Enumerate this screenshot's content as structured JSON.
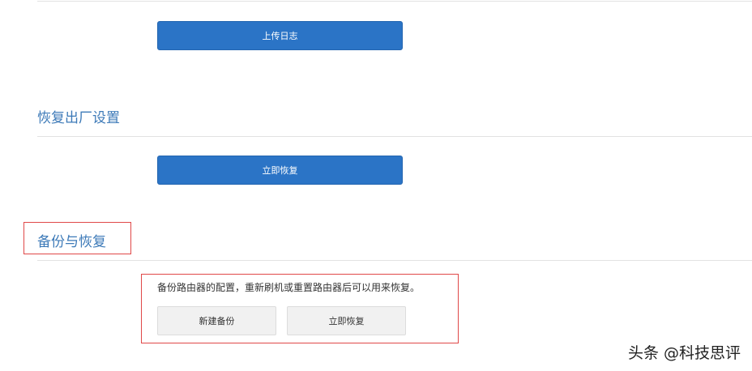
{
  "upload_log": {
    "button_label": "上传日志"
  },
  "factory_reset": {
    "title": "恢复出厂设置",
    "button_label": "立即恢复"
  },
  "backup_restore": {
    "title": "备份与恢复",
    "description": "备份路由器的配置，重新刷机或重置路由器后可以用来恢复。",
    "new_backup_label": "新建备份",
    "restore_now_label": "立即恢复"
  },
  "watermark": {
    "text": "头条 @科技思评"
  },
  "colors": {
    "primary_button": "#2b74c6",
    "section_title": "#3d7ab8",
    "highlight_border": "#e04848",
    "secondary_button": "#f1f1f1"
  }
}
